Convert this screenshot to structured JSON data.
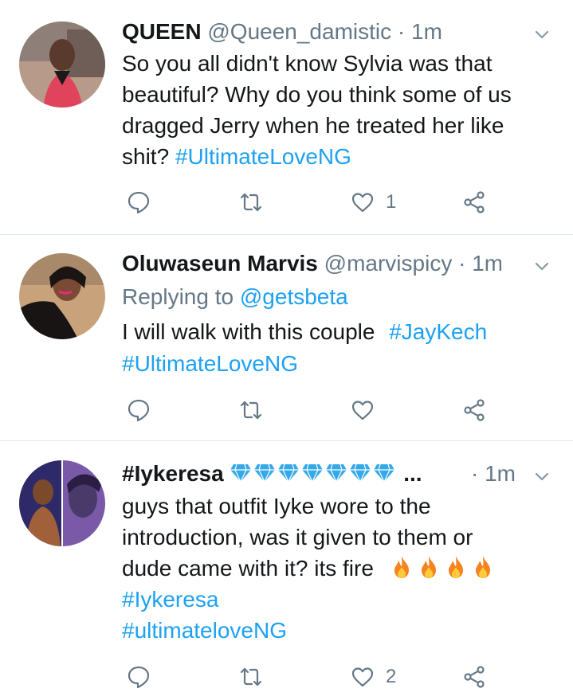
{
  "tweets": [
    {
      "display_name": "QUEEN",
      "handle": "@Queen_damistic",
      "separator": "·",
      "time": "1m",
      "lines": [
        "So you all didn't know Sylvia was that",
        "beautiful? Why do you think some of us",
        "dragged Jerry when he treated her like",
        "shit?"
      ],
      "hashtag": "#UltimateLoveNG",
      "like_count": "1"
    },
    {
      "display_name": "Oluwaseun Marvis",
      "handle": "@marvispicy",
      "separator": "·",
      "time": "1m",
      "reply_prefix": "Replying to",
      "reply_to": "@getsbeta",
      "line1": "I will walk with this couple",
      "hashtag1": "#JayKech",
      "hashtag2": "#UltimateLoveNG",
      "like_count": ""
    },
    {
      "display_name": "#Iykeresa",
      "name_suffix": "...",
      "separator": "·",
      "time": "1m",
      "lines": [
        "guys that outfit Iyke wore to the",
        "introduction, was it given to them or",
        "dude came with it? its fire"
      ],
      "hashtag1": "#Iykeresa",
      "hashtag2": "#ultimateloveNG",
      "like_count": "2"
    }
  ],
  "icons": {
    "reply": "reply-icon",
    "retweet": "retweet-icon",
    "like": "heart-icon",
    "share": "share-icon",
    "menu": "chevron-down-icon"
  },
  "colors": {
    "accent": "#1da1f2",
    "muted": "#657786",
    "text": "#14171a",
    "divider": "#e1e8ed"
  }
}
